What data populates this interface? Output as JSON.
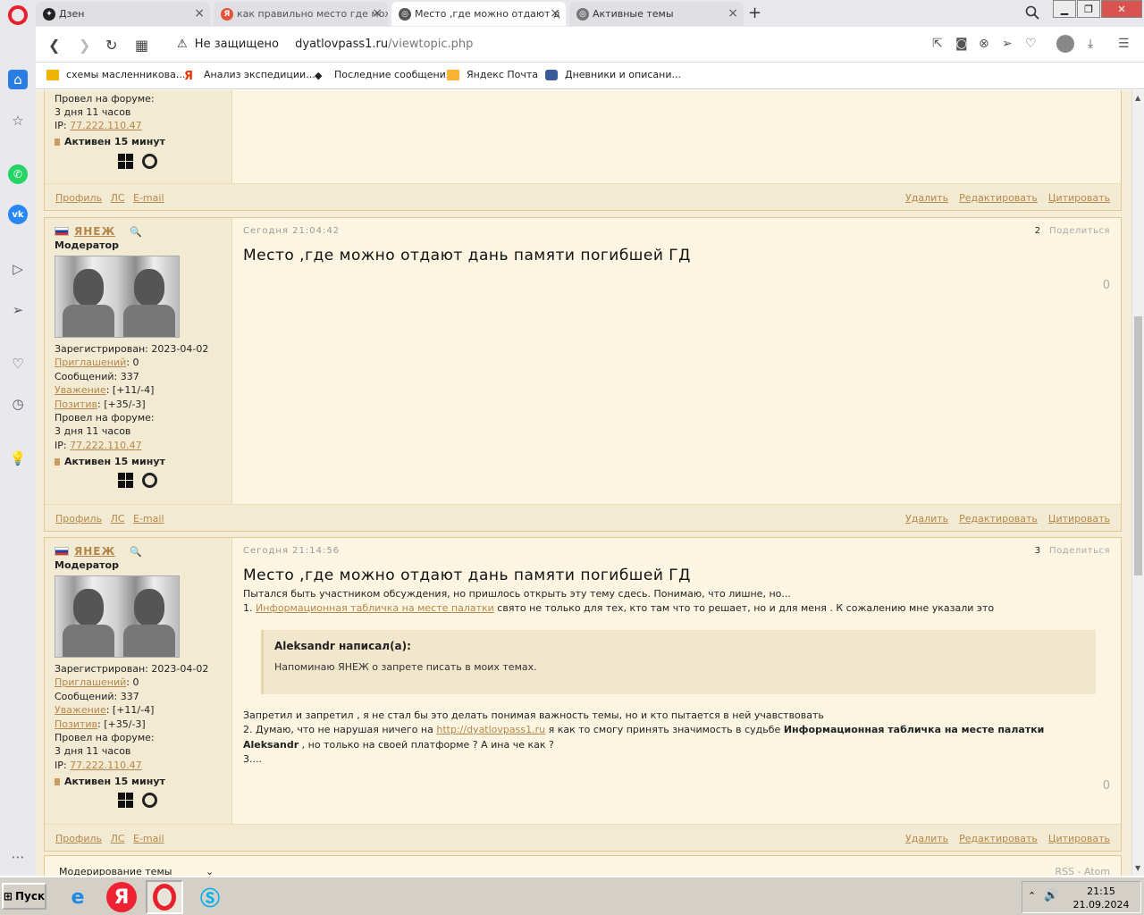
{
  "tabs": [
    {
      "label": "Дзен",
      "favicon": "dzen-icon",
      "color": "#222222",
      "active": false
    },
    {
      "label": "как правильно место где можн",
      "favicon": "yandex-icon",
      "color": "#e8523a",
      "active": false
    },
    {
      "label": "Место ,где можно отдают д",
      "favicon": "globe-icon",
      "color": "#555555",
      "active": true
    },
    {
      "label": "Активные темы",
      "favicon": "globe-icon",
      "color": "#777777",
      "active": false
    }
  ],
  "address": {
    "security": "Не защищено",
    "host": "dyatlovpass1.ru",
    "path": "/viewtopic.php"
  },
  "bookmarks": [
    {
      "label": "схемы масленникова..."
    },
    {
      "label": "Анализ экспедиции..."
    },
    {
      "label": "Последние сообщения"
    },
    {
      "label": "Яндекс Почта"
    },
    {
      "label": "Дневники и описани..."
    }
  ],
  "profile_common": {
    "registered": "Зарегистрирован: 2023-04-02",
    "invites_label": "Приглашений",
    "invites_value": ": 0",
    "messages": "Сообщений: 337",
    "respect_label": "Уважение",
    "respect_value": ": [+11/-4]",
    "positive_label": "Позитив",
    "positive_value": ": [+35/-3]",
    "forum_time_label": "Провел на форуме:",
    "forum_time_value": "3 дня 11 часов",
    "ip_label": "IP: ",
    "ip_value": "77.222.110.47",
    "active": "Активен 15 минут"
  },
  "footer_links": {
    "profile": "Профиль",
    "pm": "ЛС",
    "email": "E-mail",
    "delete": "Удалить",
    "edit": "Редактировать",
    "quote": "Цитировать"
  },
  "posts": [
    {
      "author": "ЯНЕЖ",
      "role": "Модератор",
      "date": "Сегодня 21:04:42",
      "num": "2",
      "share": "Поделиться",
      "title": "Место ,где можно отдают дань памяти погибшей ГД",
      "rating": "0"
    },
    {
      "author": "ЯНЕЖ",
      "role": "Модератор",
      "date": "Сегодня 21:14:56",
      "num": "3",
      "share": "Поделиться",
      "title": "Место ,где можно отдают дань памяти погибшей ГД",
      "rating": "0",
      "line1": "Пытался быть участником обсуждения, но пришлось открыть эту тему сдесь. Понимаю, что лишне, но...",
      "line2_prefix": "1. ",
      "line2_link": "Информационная табличка на месте палатки",
      "line2_rest": "  свято не только для тех, кто там что то решает, но и для меня  . К сожалению мне указали  это",
      "quote_author": "Aleksandr написал(а):",
      "quote_text": "Напоминаю ЯНЕЖ  о запрете писать в моих темах.",
      "line3": "  Запретил и запретил , я не стал бы это делать понимая  важность темы, но и кто пытается в ней учавствовать",
      "line4_prefix": "2. Думаю, что не нарушая ничего на ",
      "line4_link": "http://dyatlovpass1.ru",
      "line4_rest": " я как то смогу принять значимость в судьбе ",
      "line4_bold": "Информационная табличка на месте палатки",
      "line5_bold": "Aleksandr",
      "line5_rest": " , но только на своей платформе ? А ина че как ?",
      "line6": "3...."
    }
  ],
  "moderation": {
    "label": "Модерирование темы",
    "rss": "RSS",
    "sep": " - ",
    "atom": "Atom"
  },
  "taskbar": {
    "start": "Пуск",
    "time": "21:15",
    "date": "21.09.2024"
  },
  "colors": {
    "link": "#b5884a",
    "post_bg": "#fbf5e2",
    "border": "#e0c890",
    "opera_red": "#e8202c"
  }
}
